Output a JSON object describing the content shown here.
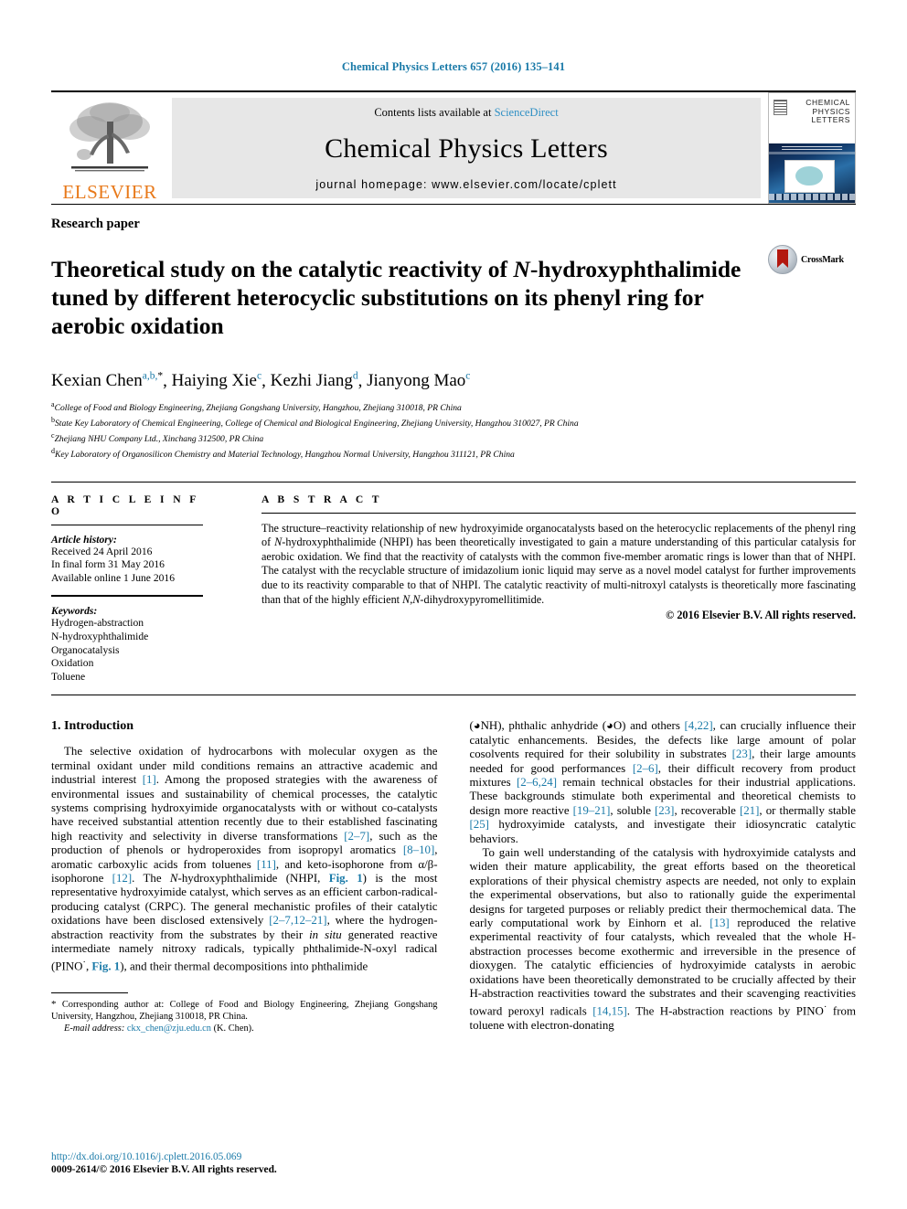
{
  "running_head": "Chemical Physics Letters 657 (2016) 135–141",
  "masthead": {
    "publisher_logo_text": "ELSEVIER",
    "contents_prefix": "Contents lists available at ",
    "contents_link": "ScienceDirect",
    "journal_title": "Chemical Physics Letters",
    "homepage": "journal homepage: www.elsevier.com/locate/cplett",
    "cover_title_lines": [
      "CHEMICAL",
      "PHYSICS",
      "LETTERS"
    ]
  },
  "article": {
    "type": "Research paper",
    "title_part1": "Theoretical study on the catalytic reactivity of ",
    "title_italic": "N",
    "title_part2": "-hydroxyphthalimide tuned by different heterocyclic substitutions on its phenyl ring for aerobic oxidation",
    "crossmark_label": "CrossMark",
    "authors": [
      {
        "name": "Kexian Chen",
        "marks": "a,b,",
        "star": "*"
      },
      {
        "name": "Haiying Xie",
        "marks": "c",
        "star": ""
      },
      {
        "name": "Kezhi Jiang",
        "marks": "d",
        "star": ""
      },
      {
        "name": "Jianyong Mao",
        "marks": "c",
        "star": ""
      }
    ],
    "affiliations": [
      {
        "mark": "a",
        "text": "College of Food and Biology Engineering, Zhejiang Gongshang University, Hangzhou, Zhejiang 310018, PR China"
      },
      {
        "mark": "b",
        "text": "State Key Laboratory of Chemical Engineering, College of Chemical and Biological Engineering, Zhejiang University, Hangzhou 310027, PR China"
      },
      {
        "mark": "c",
        "text": "Zhejiang NHU Company Ltd., Xinchang 312500, PR China"
      },
      {
        "mark": "d",
        "text": "Key Laboratory of Organosilicon Chemistry and Material Technology, Hangzhou Normal University, Hangzhou 311121, PR China"
      }
    ]
  },
  "article_info": {
    "heading": "A R T I C L E  I N F O",
    "history_label": "Article history:",
    "history": [
      "Received 24 April 2016",
      "In final form 31 May 2016",
      "Available online 1 June 2016"
    ],
    "keywords_label": "Keywords:",
    "keywords": [
      "Hydrogen-abstraction",
      "N-hydroxyphthalimide",
      "Organocatalysis",
      "Oxidation",
      "Toluene"
    ]
  },
  "abstract": {
    "heading": "A B S T R A C T",
    "text_a": "The structure–reactivity relationship of new hydroxyimide organocatalysts based on the heterocyclic replacements of the phenyl ring of ",
    "text_italic_1": "N",
    "text_b": "-hydroxyphthalimide (NHPI) has been theoretically investigated to gain a mature understanding of this particular catalysis for aerobic oxidation. We find that the reactivity of catalysts with the common five-member aromatic rings is lower than that of NHPI. The catalyst with the recyclable structure of imidazolium ionic liquid may serve as a novel model catalyst for further improvements due to its reactivity comparable to that of NHPI. The catalytic reactivity of multi-nitroxyl catalysts is theoretically more fascinating than that of the highly efficient ",
    "text_italic_2": "N,N",
    "text_c": "-dihydroxypyromellitimide.",
    "copyright": "© 2016 Elsevier B.V. All rights reserved."
  },
  "introduction": {
    "heading": "1. Introduction",
    "left_paragraph_1_a": "The selective oxidation of hydrocarbons with molecular oxygen as the terminal oxidant under mild conditions remains an attractive academic and industrial interest ",
    "ref_1": "[1]",
    "left_paragraph_1_b": ". Among the proposed strategies with the awareness of environmental issues and sustainability of chemical processes, the catalytic systems comprising hydroxyimide organocatalysts with or without co-catalysts have received substantial attention recently due to their established fascinating high reactivity and selectivity in diverse transformations ",
    "ref_2_7": "[2–7]",
    "left_paragraph_1_c": ", such as the production of phenols or hydroperoxides from isopropyl aromatics ",
    "ref_8_10": "[8–10]",
    "left_paragraph_1_d": ", aromatic carboxylic acids from toluenes ",
    "ref_11": "[11]",
    "left_paragraph_1_e": ", and keto-isophorone from α/β-isophorone ",
    "ref_12": "[12]",
    "left_paragraph_1_f": ". The ",
    "italic_N1": "N",
    "left_paragraph_1_g": "-hydroxyphthalimide (NHPI, ",
    "fig_ref_1": "Fig. 1",
    "left_paragraph_1_h": ") is the most representative hydroxyimide catalyst, which serves as an efficient carbon-radical-producing catalyst (CRPC). The general mechanistic profiles of their catalytic oxidations have been disclosed extensively ",
    "ref_2_7_12_21": "[2–7,12–21]",
    "left_paragraph_1_i": ", where the hydrogen-abstraction reactivity from the substrates by their ",
    "italic_insitu": "in situ",
    "left_paragraph_1_j": " generated reactive intermediate namely nitroxy radicals, typically phthalimide-N-oxyl radical (PINO",
    "radical_dot": "·",
    "left_paragraph_1_k": ", ",
    "fig_ref_2": "Fig. 1",
    "left_paragraph_1_l": "), and their thermal decompositions into phthalimide",
    "right_paragraph_1_a": "(",
    "right_paragraph_1_b": "NH), phthalic anhydride (",
    "right_paragraph_1_c": "O) and others ",
    "ref_4_22": "[4,22]",
    "right_paragraph_1_d": ", can crucially influence their catalytic enhancements. Besides, the defects like large amount of polar cosolvents required for their solubility in substrates ",
    "ref_23": "[23]",
    "right_paragraph_1_e": ", their large amounts needed for good performances ",
    "ref_2_6": "[2–6]",
    "right_paragraph_1_f": ", their difficult recovery from product mixtures ",
    "ref_2_6_24": "[2–6,24]",
    "right_paragraph_1_g": " remain technical obstacles for their industrial applications. These backgrounds stimulate both experimental and theoretical chemists to design more reactive ",
    "ref_19_21": "[19–21]",
    "right_paragraph_1_h": ", soluble ",
    "ref_23b": "[23]",
    "right_paragraph_1_i": ", recoverable ",
    "ref_21": "[21]",
    "right_paragraph_1_j": ", or thermally stable ",
    "ref_25": "[25]",
    "right_paragraph_1_k": " hydroxyimide catalysts, and investigate their idiosyncratic catalytic behaviors.",
    "right_paragraph_2_a": "To gain well understanding of the catalysis with hydroxyimide catalysts and widen their mature applicability, the great efforts based on the theoretical explorations of their physical chemistry aspects are needed, not only to explain the experimental observations, but also to rationally guide the experimental designs for targeted purposes or reliably predict their thermochemical data. The early computational work by Einhorn et al. ",
    "ref_13": "[13]",
    "right_paragraph_2_b": " reproduced the relative experimental reactivity of four catalysts, which revealed that the whole H-abstraction processes become exothermic and irreversible in the presence of dioxygen. The catalytic efficiencies of hydroxyimide catalysts in aerobic oxidations have been theoretically demonstrated to be crucially affected by their H-abstraction reactivities toward the substrates and their scavenging reactivities toward peroxyl radicals ",
    "ref_14_15": "[14,15]",
    "right_paragraph_2_c": ". The H-abstraction reactions by PINO",
    "radical_dot_2": "·",
    "right_paragraph_2_d": " from toluene with electron-donating"
  },
  "footnote": {
    "star": "*",
    "corresponding": " Corresponding author at: College of Food and Biology Engineering, Zhejiang Gongshang University, Hangzhou, Zhejiang 310018, PR China.",
    "email_label": "E-mail address:",
    "email": "ckx_chen@zju.edu.cn",
    "email_suffix": " (K. Chen)."
  },
  "page_footer": {
    "doi": "http://dx.doi.org/10.1016/j.cplett.2016.05.069",
    "issn_line": "0009-2614/© 2016 Elsevier B.V. All rights reserved."
  },
  "colors": {
    "link_blue": "#1a7aa8",
    "elsevier_orange": "#e8791a",
    "sciencedirect_blue": "#2e8fc4",
    "banner_gray": "#e7e7e7",
    "crossmark_red": "#b3180f"
  }
}
